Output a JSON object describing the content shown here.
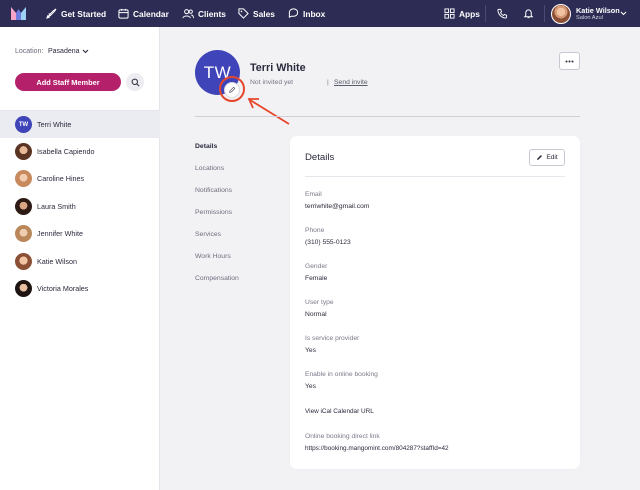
{
  "topnav": {
    "items": [
      {
        "label": "Get Started",
        "icon": "rocket-icon"
      },
      {
        "label": "Calendar",
        "icon": "calendar-icon"
      },
      {
        "label": "Clients",
        "icon": "clients-icon"
      },
      {
        "label": "Sales",
        "icon": "tag-icon"
      },
      {
        "label": "Inbox",
        "icon": "inbox-icon"
      }
    ],
    "apps_label": "Apps",
    "user": {
      "name": "Katie Wilson",
      "subtitle": "Salon Azul"
    },
    "colors": {
      "background": "#2c2c54",
      "accent": "#b5206a"
    }
  },
  "sidebar": {
    "location_label": "Location:",
    "location_value": "Pasadena",
    "add_button": "Add Staff Member",
    "staff": [
      {
        "name": "Terri White",
        "initials": "TW",
        "active": true
      },
      {
        "name": "Isabella Capiendo"
      },
      {
        "name": "Caroline Hines"
      },
      {
        "name": "Laura Smith"
      },
      {
        "name": "Jennifer White"
      },
      {
        "name": "Katie Wilson"
      },
      {
        "name": "Victoria Morales"
      }
    ]
  },
  "profile": {
    "initials": "TW",
    "name": "Terri White",
    "invite_status": "Not invited yet",
    "separator": "|",
    "send_invite": "Send invite"
  },
  "subnav": [
    "Details",
    "Locations",
    "Notifications",
    "Permissions",
    "Services",
    "Work Hours",
    "Compensation"
  ],
  "details": {
    "title": "Details",
    "edit_label": "Edit",
    "fields": [
      {
        "label": "Email",
        "value": "terriwhite@gmail.com"
      },
      {
        "label": "Phone",
        "value": "(310) 555-0123"
      },
      {
        "label": "Gender",
        "value": "Female"
      },
      {
        "label": "User type",
        "value": "Normal"
      },
      {
        "label": "Is service provider",
        "value": "Yes"
      },
      {
        "label": "Enable in online booking",
        "value": "Yes"
      }
    ],
    "ical_link": "View iCal Calendar URL",
    "booking_label": "Online booking direct link",
    "booking_url": "https://booking.mangomint.com/804287?staffId=42"
  }
}
